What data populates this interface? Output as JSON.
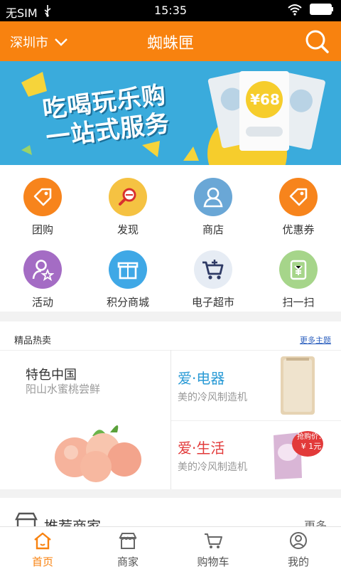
{
  "status": {
    "carrier": "无SIM",
    "time": "15:35"
  },
  "header": {
    "city": "深圳市",
    "title": "蜘蛛匣"
  },
  "banner": {
    "slogan_line1": "吃喝玩乐购",
    "slogan_line2": "一站式服务",
    "ticket_price": "¥68"
  },
  "menu": {
    "items": [
      {
        "label": "团购",
        "icon": "tag-icon",
        "color": "#f7841c"
      },
      {
        "label": "发现",
        "icon": "magnifier-icon",
        "color": "#f5c242"
      },
      {
        "label": "商店",
        "icon": "user-icon",
        "color": "#6aa7d6"
      },
      {
        "label": "优惠券",
        "icon": "coupon-tag-icon",
        "color": "#f7841c"
      },
      {
        "label": "活动",
        "icon": "user-star-icon",
        "color": "#a46cc4"
      },
      {
        "label": "积分商城",
        "icon": "gift-icon",
        "color": "#3fa8e6"
      },
      {
        "label": "电子超市",
        "icon": "cart-icon",
        "color": "#5a8ed0"
      },
      {
        "label": "扫一扫",
        "icon": "scan-icon",
        "color": "#a6d58a"
      }
    ]
  },
  "hot": {
    "title": "精品热卖",
    "more": "更多主题",
    "left": {
      "title": "特色中国",
      "subtitle": "阳山水蜜桃尝鲜"
    },
    "right1": {
      "title": "爱·电器",
      "subtitle": "美的冷风制造机"
    },
    "right2": {
      "title": "爱·生活",
      "subtitle": "美的冷风制造机",
      "badge_line1": "抢购价：",
      "badge_line2": "¥ 1元"
    }
  },
  "recommend": {
    "title": "推荐商家",
    "more": "更多"
  },
  "tabbar": {
    "tabs": [
      {
        "label": "首页",
        "active": true
      },
      {
        "label": "商家",
        "active": false
      },
      {
        "label": "购物车",
        "active": false
      },
      {
        "label": "我的",
        "active": false
      }
    ]
  },
  "colors": {
    "brand": "#f8820f",
    "banner": "#3aabdc"
  }
}
